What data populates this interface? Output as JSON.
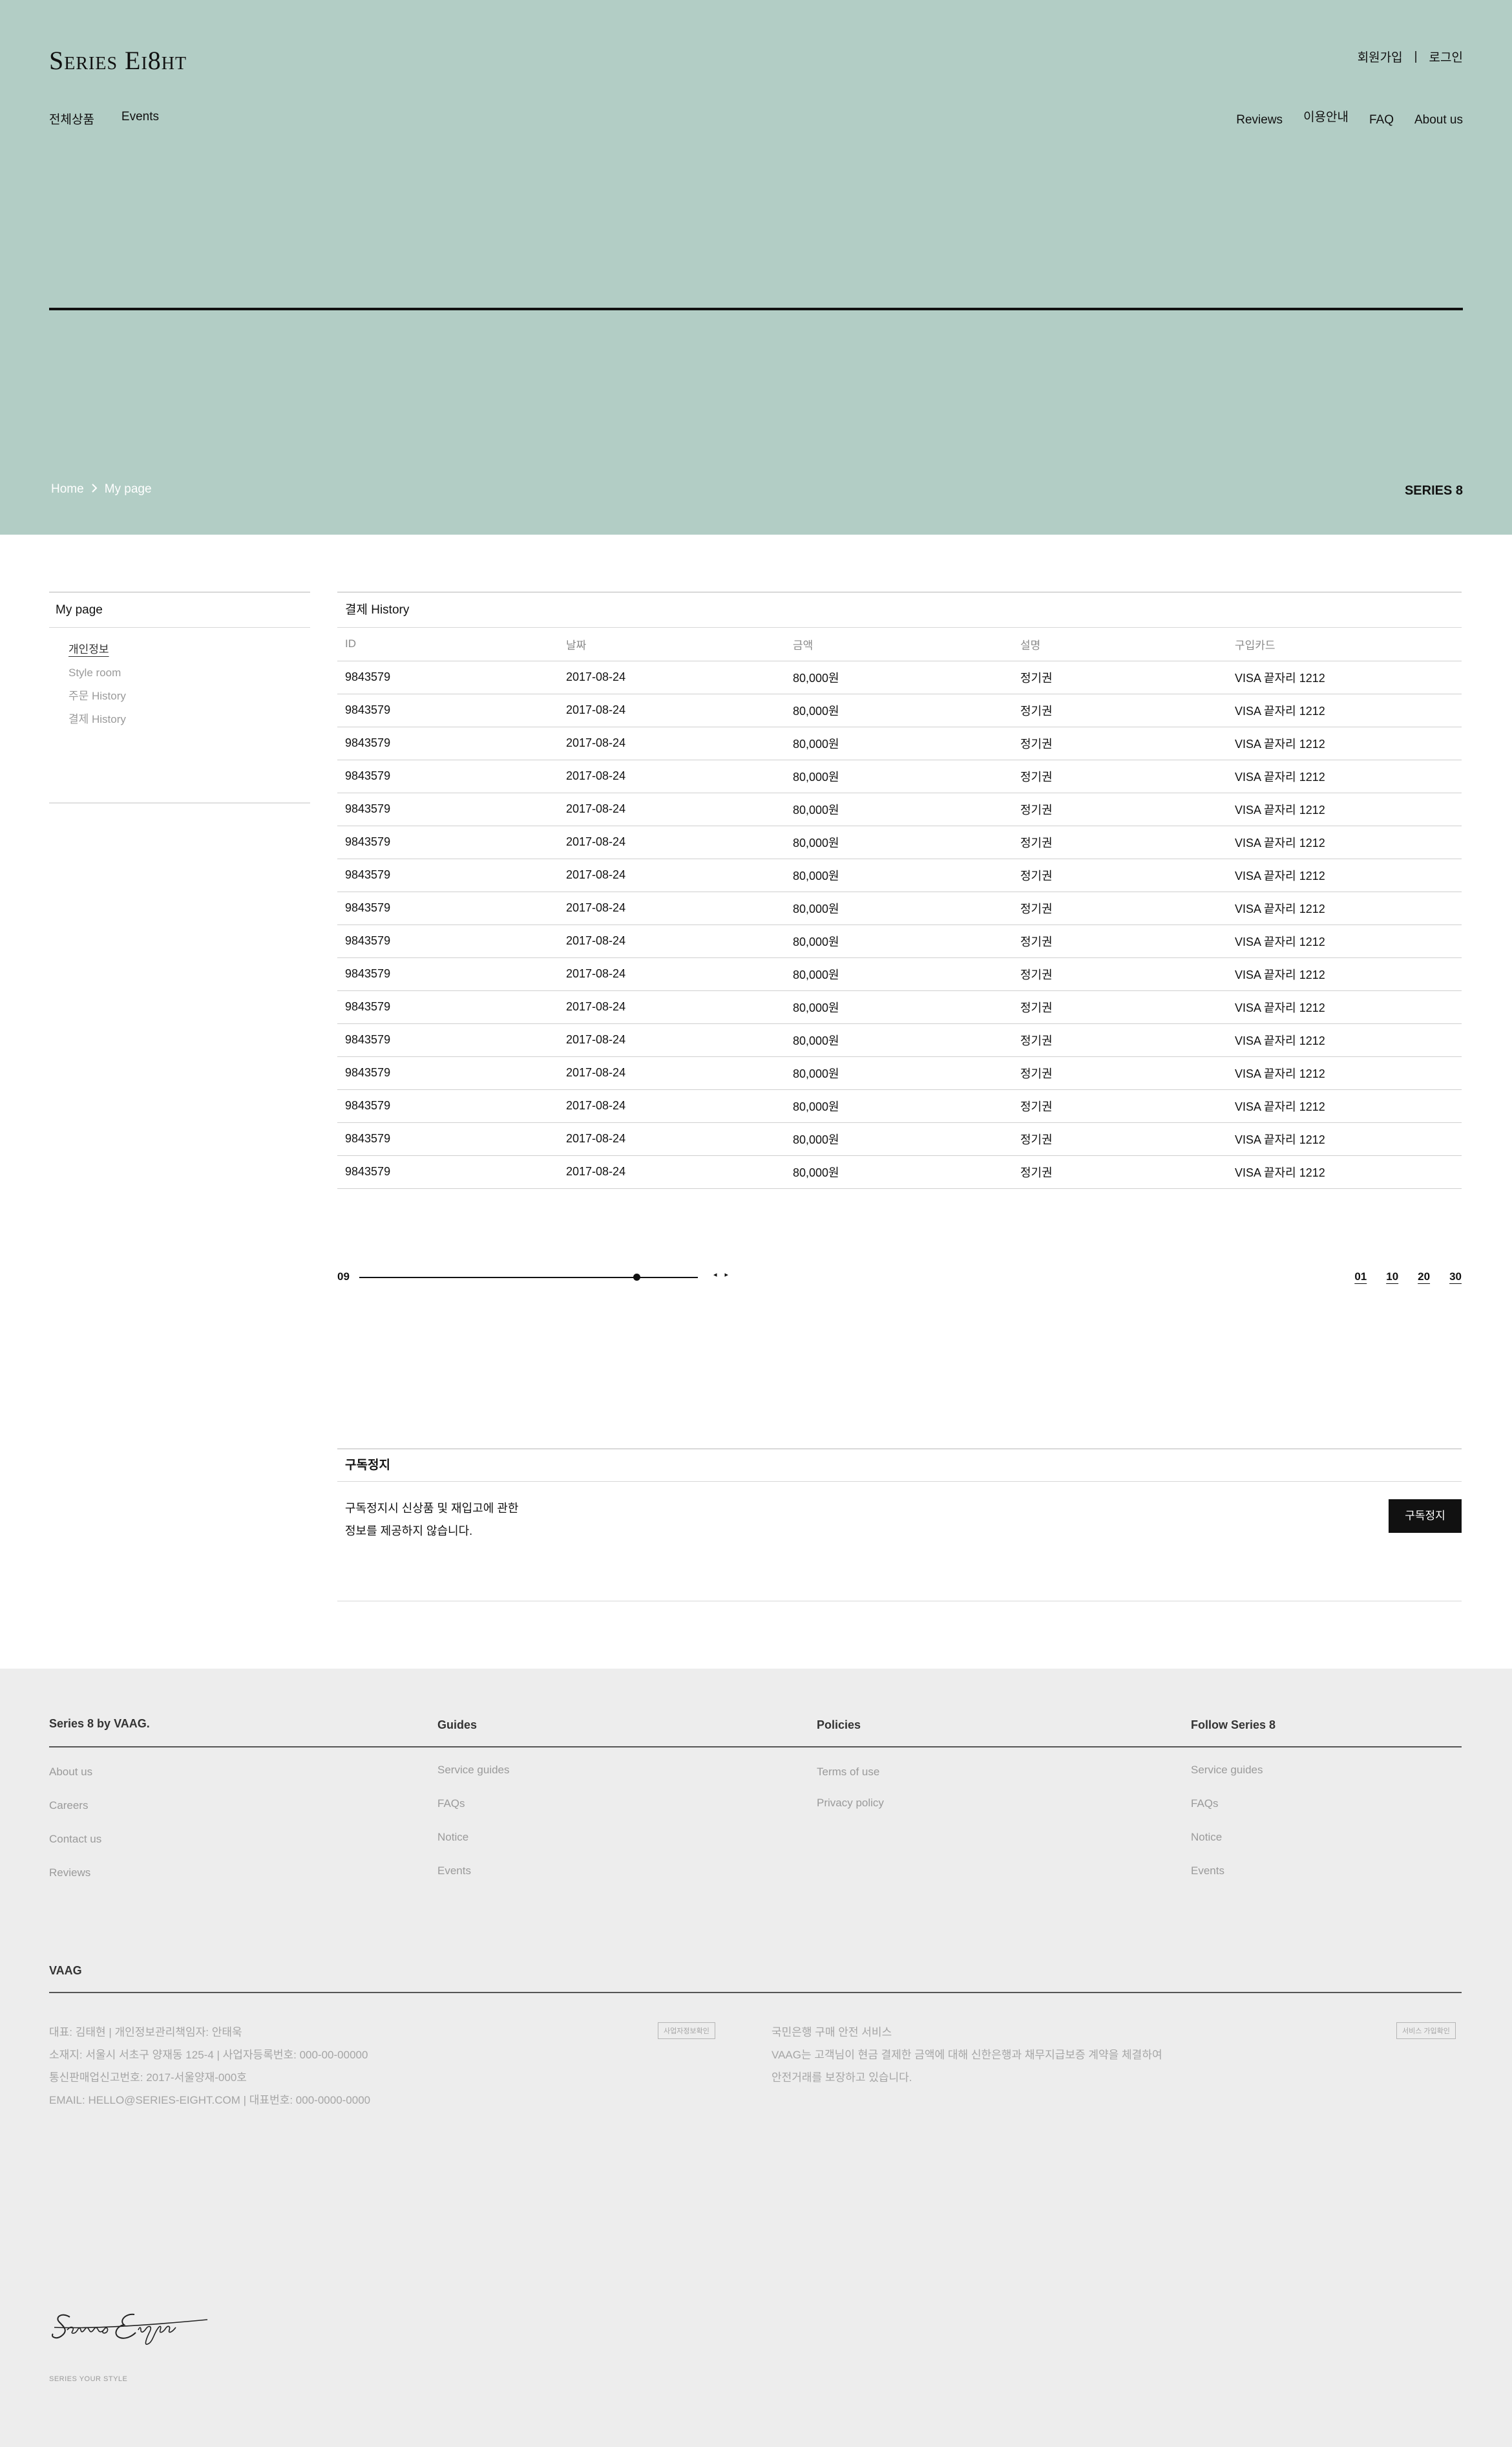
{
  "header": {
    "logo": "Series Ei8ht",
    "auth": {
      "signup": "회원가입",
      "separator": "|",
      "login": "로그인"
    },
    "nav_left": [
      "전체상품",
      "Events"
    ],
    "nav_right": [
      "Reviews",
      "이용안내",
      "FAQ",
      "About us"
    ],
    "breadcrumb": {
      "home": "Home",
      "current": "My page"
    },
    "brand": "SERIES 8",
    "hero_color": "#b2cdc5"
  },
  "sidebar": {
    "title": "My page",
    "items": [
      {
        "label": "개인정보",
        "active": true
      },
      {
        "label": "Style room",
        "active": false
      },
      {
        "label": "주문 History",
        "active": false
      },
      {
        "label": "결제 History",
        "active": false
      }
    ]
  },
  "payment_history": {
    "title": "결제 History",
    "columns": [
      "ID",
      "날짜",
      "금액",
      "설명",
      "구입카드"
    ],
    "rows": [
      [
        "9843579",
        "2017-08-24",
        "80,000원",
        "정기권",
        "VISA 끝자리 1212"
      ],
      [
        "9843579",
        "2017-08-24",
        "80,000원",
        "정기권",
        "VISA 끝자리 1212"
      ],
      [
        "9843579",
        "2017-08-24",
        "80,000원",
        "정기권",
        "VISA 끝자리 1212"
      ],
      [
        "9843579",
        "2017-08-24",
        "80,000원",
        "정기권",
        "VISA 끝자리 1212"
      ],
      [
        "9843579",
        "2017-08-24",
        "80,000원",
        "정기권",
        "VISA 끝자리 1212"
      ],
      [
        "9843579",
        "2017-08-24",
        "80,000원",
        "정기권",
        "VISA 끝자리 1212"
      ],
      [
        "9843579",
        "2017-08-24",
        "80,000원",
        "정기권",
        "VISA 끝자리 1212"
      ],
      [
        "9843579",
        "2017-08-24",
        "80,000원",
        "정기권",
        "VISA 끝자리 1212"
      ],
      [
        "9843579",
        "2017-08-24",
        "80,000원",
        "정기권",
        "VISA 끝자리 1212"
      ],
      [
        "9843579",
        "2017-08-24",
        "80,000원",
        "정기권",
        "VISA 끝자리 1212"
      ],
      [
        "9843579",
        "2017-08-24",
        "80,000원",
        "정기권",
        "VISA 끝자리 1212"
      ],
      [
        "9843579",
        "2017-08-24",
        "80,000원",
        "정기권",
        "VISA 끝자리 1212"
      ],
      [
        "9843579",
        "2017-08-24",
        "80,000원",
        "정기권",
        "VISA 끝자리 1212"
      ],
      [
        "9843579",
        "2017-08-24",
        "80,000원",
        "정기권",
        "VISA 끝자리 1212"
      ],
      [
        "9843579",
        "2017-08-24",
        "80,000원",
        "정기권",
        "VISA 끝자리 1212"
      ],
      [
        "9843579",
        "2017-08-24",
        "80,000원",
        "정기권",
        "VISA 끝자리 1212"
      ]
    ]
  },
  "pager": {
    "current": "09",
    "progress": 0.82,
    "prev_icon": "◂",
    "next_icon": "▸",
    "page_sizes": [
      "01",
      "10",
      "20",
      "30"
    ]
  },
  "subscription_stop": {
    "title": "구독정지",
    "desc_line1": "구독정지시 신상품 및 재입고에 관한",
    "desc_line2": "정보를 제공하지 않습니다.",
    "button": "구독정지"
  },
  "footer": {
    "columns": [
      {
        "title": "Series 8  by VAAG.",
        "items": [
          "About us",
          "Careers",
          "Contact us",
          "Reviews"
        ]
      },
      {
        "title": "Guides",
        "items": [
          "Service guides",
          "FAQs",
          "Notice",
          "Events"
        ]
      },
      {
        "title": "Policies",
        "items": [
          "Terms of use",
          "Privacy policy"
        ]
      },
      {
        "title": "Follow Series 8",
        "items": [
          "Service guides",
          "FAQs",
          "Notice",
          "Events"
        ]
      }
    ],
    "vaag_title": "VAAG",
    "company_info": [
      "대표: 김태현  |  개인정보관리책임자: 안태욱",
      "소재지: 서울시 서초구 양재동 125-4  |  사업자등록번호: 000-00-00000",
      "통신판매업신고번호: 2017-서울양재-000호",
      "EMAIL: HELLO@SERIES-EIGHT.COM  |  대표번호: 000-0000-0000"
    ],
    "company_badge": "사업자정보확인",
    "safety_info": [
      "국민은행 구매 안전 서비스",
      "VAAG는 고객님이 현금 결제한 금액에 대해 신한은행과 채무지급보증 계약을 체결하여",
      "안전거래를 보장하고 있습니다."
    ],
    "safety_badge": "서비스 가입확인",
    "signature": "Series Eight",
    "tagline": "SERIES YOUR STYLE"
  }
}
